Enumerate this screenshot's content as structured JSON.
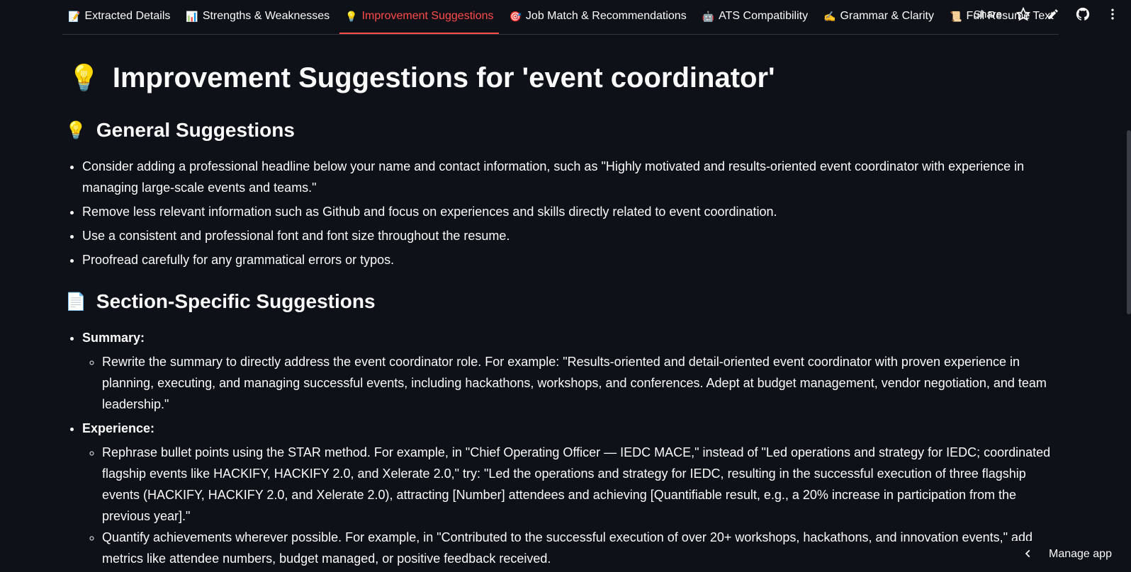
{
  "tabs": [
    {
      "icon": "📝",
      "label": "Extracted Details",
      "active": false
    },
    {
      "icon": "📊",
      "label": "Strengths & Weaknesses",
      "active": false
    },
    {
      "icon": "💡",
      "label": "Improvement Suggestions",
      "active": true
    },
    {
      "icon": "🎯",
      "label": "Job Match & Recommendations",
      "active": false
    },
    {
      "icon": "🤖",
      "label": "ATS Compatibility",
      "active": false
    },
    {
      "icon": "✍️",
      "label": "Grammar & Clarity",
      "active": false
    },
    {
      "icon": "📜",
      "label": "Full Resume Text",
      "active": false
    }
  ],
  "toolbar": {
    "share_label": "Share",
    "icons": [
      "star-icon",
      "edit-icon",
      "github-icon",
      "more-vertical-icon"
    ]
  },
  "main": {
    "title_icon": "💡",
    "title": "Improvement Suggestions for 'event coordinator'",
    "general": {
      "icon": "💡",
      "heading": "General Suggestions",
      "items": [
        "Consider adding a professional headline below your name and contact information, such as \"Highly motivated and results-oriented event coordinator with experience in managing large-scale events and teams.\"",
        "Remove less relevant information such as Github and focus on experiences and skills directly related to event coordination.",
        "Use a consistent and professional font and font size throughout the resume.",
        "Proofread carefully for any grammatical errors or typos."
      ]
    },
    "section": {
      "icon": "📄",
      "heading": "Section-Specific Suggestions",
      "groups": [
        {
          "label": "Summary:",
          "items": [
            "Rewrite the summary to directly address the event coordinator role. For example: \"Results-oriented and detail-oriented event coordinator with proven experience in planning, executing, and managing successful events, including hackathons, workshops, and conferences. Adept at budget management, vendor negotiation, and team leadership.\""
          ]
        },
        {
          "label": "Experience:",
          "items": [
            "Rephrase bullet points using the STAR method. For example, in \"Chief Operating Officer — IEDC MACE,\" instead of \"Led operations and strategy for IEDC; coordinated flagship events like HACKIFY, HACKIFY 2.0, and Xelerate 2.0,\" try: \"Led the operations and strategy for IEDC, resulting in the successful execution of three flagship events (HACKIFY, HACKIFY 2.0, and Xelerate 2.0), attracting [Number] attendees and achieving [Quantifiable result, e.g., a 20% increase in participation from the previous year].\"",
            "Quantify achievements wherever possible. For example, in \"Contributed to the successful execution of over 20+ workshops, hackathons, and innovation events,\" add metrics like attendee numbers, budget managed, or positive feedback received."
          ]
        }
      ]
    }
  },
  "manage_app": {
    "label": "Manage app"
  }
}
